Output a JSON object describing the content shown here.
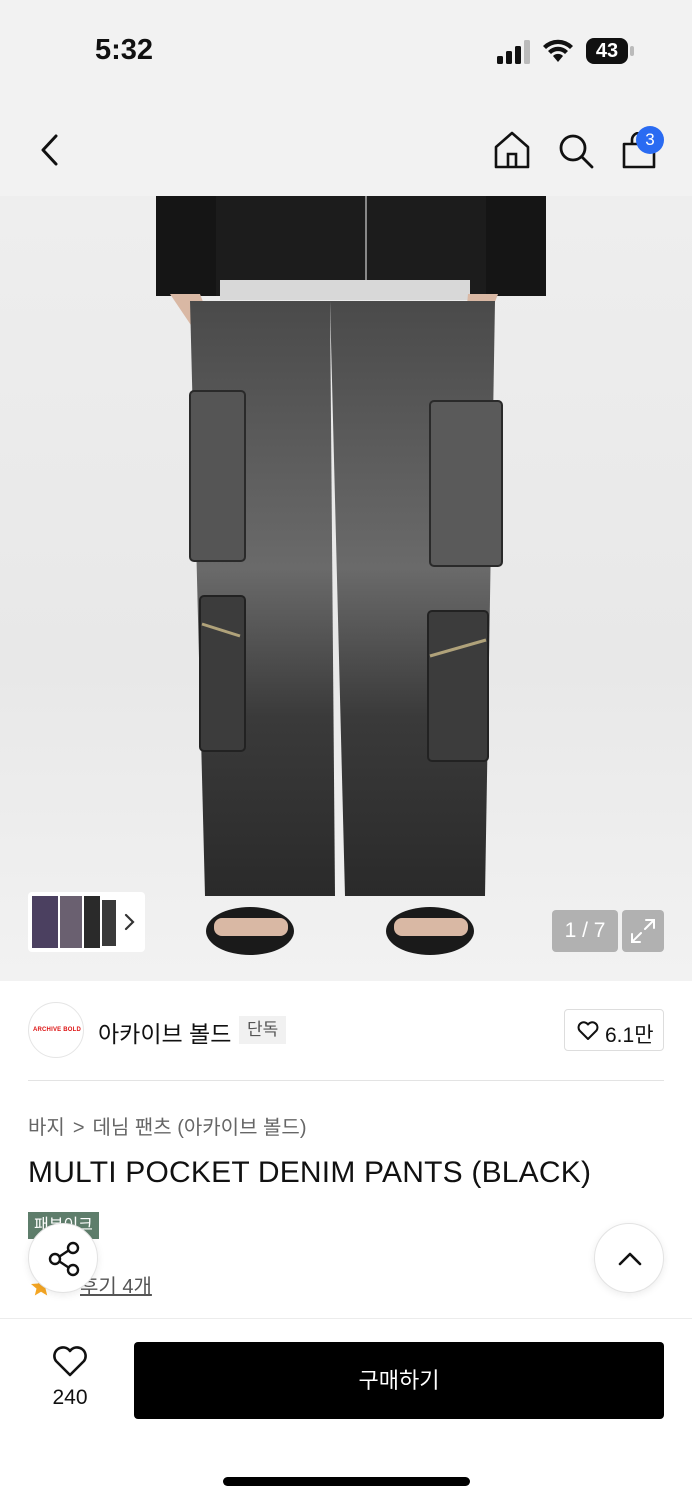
{
  "status_bar": {
    "time": "5:32",
    "battery": "43"
  },
  "nav": {
    "back_icon": "chevron-left-icon",
    "home_icon": "home-icon",
    "search_icon": "search-icon",
    "cart_icon": "shopping-bag-icon",
    "cart_count": "3"
  },
  "gallery": {
    "counter": "1 / 7",
    "more_icon": "chevron-right-icon",
    "expand_icon": "expand-icon"
  },
  "brand": {
    "logo_text": "ARCHIVE BOLD",
    "name": "아카이브 볼드",
    "badge": "단독",
    "like_count": "6.1만"
  },
  "product": {
    "breadcrumb": [
      "바지",
      "데님 팬츠 (아카이브 볼드)"
    ],
    "title": "MULTI POCKET DENIM PANTS (BLACK)",
    "tag": "패부이크",
    "review_label": "후기 4개"
  },
  "bottom_bar": {
    "wish_count": "240",
    "buy_label": "구매하기"
  },
  "colors": {
    "badge_blue": "#2a6bf2",
    "tag_green": "#5e7d6b",
    "star": "#f5a623",
    "buy_button": "#000000"
  }
}
